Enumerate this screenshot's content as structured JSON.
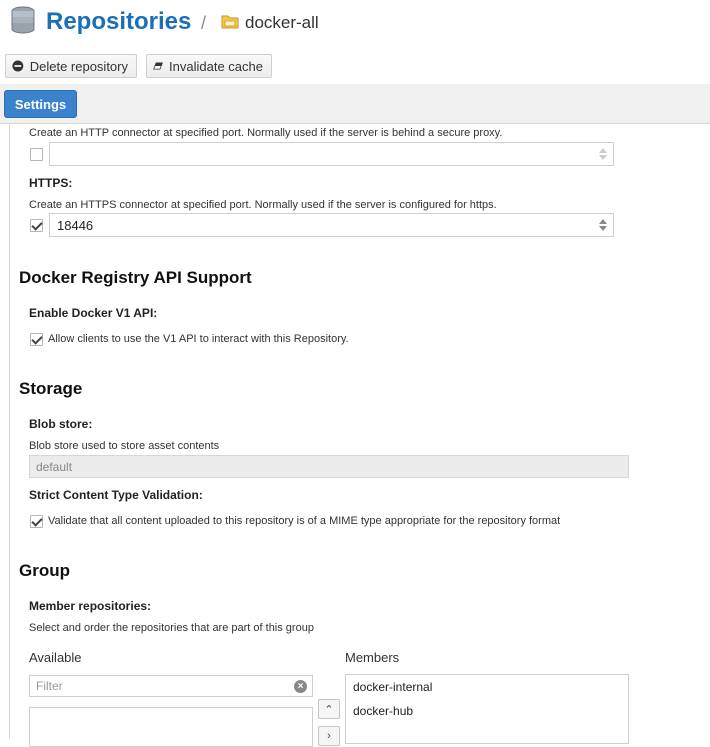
{
  "header": {
    "title": "Repositories",
    "separator": "/",
    "repo_name": "docker-all"
  },
  "toolbar": {
    "delete_label": "Delete repository",
    "invalidate_label": "Invalidate cache"
  },
  "tabs": {
    "settings_label": "Settings"
  },
  "connectors": {
    "http_help": "Create an HTTP connector at specified port. Normally used if the server is behind a secure proxy.",
    "http_checked": false,
    "http_port": "",
    "https_label": "HTTPS:",
    "https_help": "Create an HTTPS connector at specified port. Normally used if the server is configured for https.",
    "https_checked": true,
    "https_port": "18446"
  },
  "docker_api": {
    "section_title": "Docker Registry API Support",
    "v1_label": "Enable Docker V1 API:",
    "v1_checkbox_label": "Allow clients to use the V1 API to interact with this Repository.",
    "v1_checked": true
  },
  "storage": {
    "section_title": "Storage",
    "blob_label": "Blob store:",
    "blob_help": "Blob store used to store asset contents",
    "blob_value": "default",
    "strict_label": "Strict Content Type Validation:",
    "strict_checkbox_label": "Validate that all content uploaded to this repository is of a MIME type appropriate for the repository format",
    "strict_checked": true
  },
  "group": {
    "section_title": "Group",
    "member_label": "Member repositories:",
    "member_help": "Select and order the repositories that are part of this group",
    "available_header": "Available",
    "members_header": "Members",
    "filter_placeholder": "Filter",
    "members": [
      "docker-internal",
      "docker-hub"
    ]
  },
  "icons": {
    "database": "database-icon",
    "folder": "folder-icon",
    "delete": "minus-circle-icon",
    "invalidate": "eraser-icon",
    "clear": "clear-icon",
    "move_up": "chevron-up-icon",
    "move_right": "chevron-right-icon"
  },
  "colors": {
    "title": "#1a6fb8",
    "settings_tab": "#3a83cc"
  }
}
